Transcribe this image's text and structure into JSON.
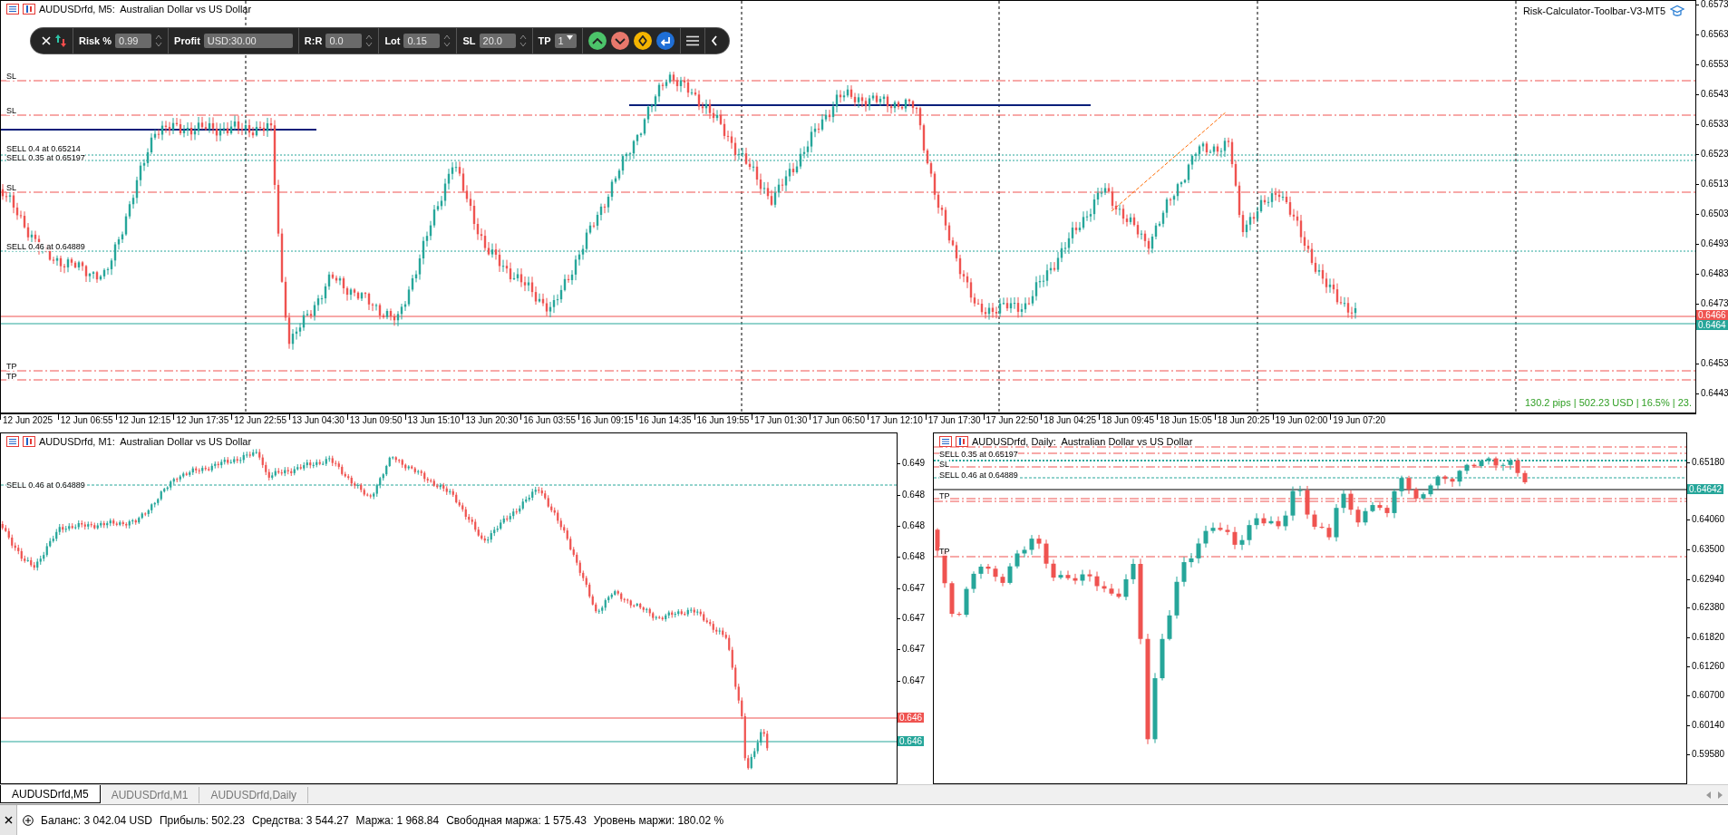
{
  "main_chart": {
    "title": "AUDUSDrfd, M5:  Australian Dollar vs US Dollar",
    "indicator": "Risk-Calculator-Toolbar-V3-MT5",
    "toolbar": {
      "fields": [
        {
          "label": "Risk %",
          "value": "0.99",
          "kind": "spin"
        },
        {
          "label": "Profit",
          "value": "USD:30.00",
          "kind": "text"
        },
        {
          "label": "R:R",
          "value": "0.0",
          "kind": "spin"
        },
        {
          "label": "Lot",
          "value": "0.15",
          "kind": "spin"
        },
        {
          "label": "SL",
          "value": "20.0",
          "kind": "spin"
        },
        {
          "label": "TP",
          "value": "1",
          "kind": "select"
        }
      ],
      "buttons": [
        {
          "kind": "up",
          "color": "#4cc46a"
        },
        {
          "kind": "down",
          "color": "#e8786c"
        },
        {
          "kind": "both",
          "color": "#f4b400"
        },
        {
          "kind": "enter",
          "color": "#1f6fd6"
        }
      ]
    },
    "line_labels": [
      "SL",
      "SL",
      "SELL 0.4 at 0.65214",
      "SELL 0.35 at 0.65197",
      "SL",
      "SELL 0.46 at 0.64889",
      "TP",
      "TP"
    ],
    "price_ticks": [
      "0.6573",
      "0.6563",
      "0.6553",
      "0.6543",
      "0.6533",
      "0.6523",
      "0.6513",
      "0.6503",
      "0.6493",
      "0.6483",
      "0.6473",
      "0.6453",
      "0.6443"
    ],
    "price_badges": [
      {
        "text": "0.6466",
        "color": "#ef5350"
      },
      {
        "text": "0.6464",
        "color": "#26a69a"
      }
    ],
    "time_ticks": [
      "12 Jun 2025",
      "12 Jun 06:55",
      "12 Jun 12:15",
      "12 Jun 17:35",
      "12 Jun 22:55",
      "13 Jun 04:30",
      "13 Jun 09:50",
      "13 Jun 15:10",
      "13 Jun 20:30",
      "16 Jun 03:55",
      "16 Jun 09:15",
      "16 Jun 14:35",
      "16 Jun 19:55",
      "17 Jun 01:30",
      "17 Jun 06:50",
      "17 Jun 12:10",
      "17 Jun 17:30",
      "17 Jun 22:50",
      "18 Jun 04:25",
      "18 Jun 09:45",
      "18 Jun 15:05",
      "18 Jun 20:25",
      "19 Jun 02:00",
      "19 Jun 07:20"
    ],
    "summary": "130.2 pips | 502.23 USD | 16.5% | 23."
  },
  "m1_chart": {
    "title": "AUDUSDrfd, M1:  Australian Dollar vs US Dollar",
    "line_labels": [
      "SELL 0.46 at 0.64889"
    ],
    "price_ticks": [
      "0.649",
      "0.648",
      "0.648",
      "0.648",
      "0.647",
      "0.647",
      "0.647",
      "0.647"
    ],
    "price_badges": [
      {
        "text": "0.646",
        "color": "#ef5350"
      },
      {
        "text": "0.646",
        "color": "#26a69a"
      }
    ]
  },
  "daily_chart": {
    "title": "AUDUSDrfd, Daily:  Australian Dollar vs US Dollar",
    "line_labels": [
      "SELL 0.35 at 0.65197",
      "SL",
      "SELL 0.46 at 0.64889",
      "TP",
      "TP"
    ],
    "price_ticks": [
      "0.65180",
      "0.64060",
      "0.63500",
      "0.62940",
      "0.62380",
      "0.61820",
      "0.61260",
      "0.60700",
      "0.60140",
      "0.59580"
    ],
    "price_badges": [
      {
        "text": "0.64642",
        "color": "#26a69a"
      }
    ]
  },
  "tabs": [
    {
      "label": "AUDUSDrfd,M5",
      "selected": true
    },
    {
      "label": "AUDUSDrfd,M1",
      "selected": false
    },
    {
      "label": "AUDUSDrfd,Daily",
      "selected": false
    }
  ],
  "status_bar": [
    "Баланс: 3 042.04 USD",
    "Прибыль: 502.23",
    "Средства: 3 544.27",
    "Маржа: 1 968.84",
    "Свободная маржа: 1 575.43",
    "Уровень маржи: 180.02 %"
  ]
}
